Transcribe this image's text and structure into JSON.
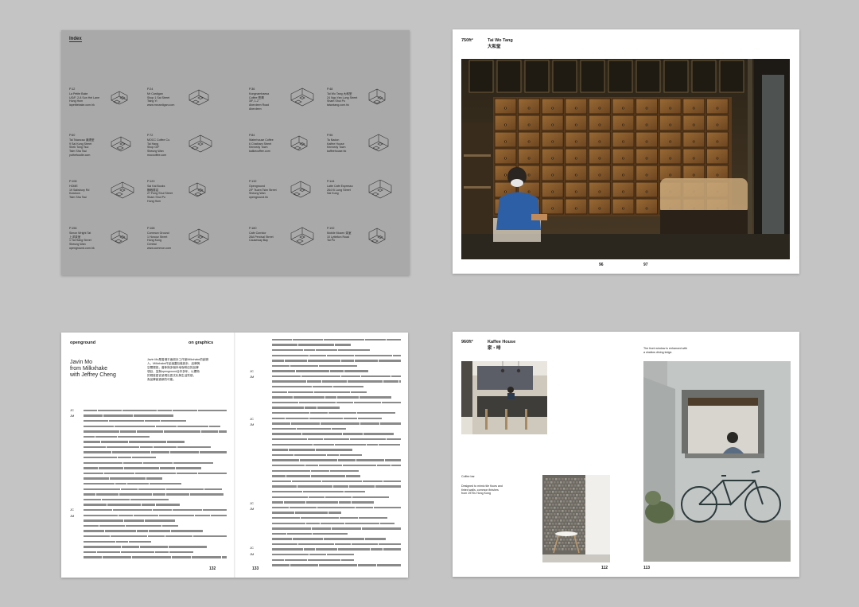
{
  "index": {
    "title": "Index",
    "entries": [
      {
        "num": "P.12",
        "lines": [
          "La Petite Bake",
          "UG/F, 2-8 Sun Hei Lane",
          "Hung Hom",
          "lapetitebake.com.hk"
        ]
      },
      {
        "num": "P.24",
        "lines": [
          "Mr Cardigan",
          "Shop 1 Sai Street",
          "Tsing Yi",
          "www.mrcardigan.com"
        ]
      },
      {
        "num": "P.36",
        "lines": [
          "Kongnamhaesa",
          "Coffee 豐潤",
          "3/F, 1-2",
          "Aberdeen Road",
          "Aberdeen"
        ]
      },
      {
        "num": "P.48",
        "lines": [
          "Tai Wo Tang 大和堂",
          "24 Ngo Yan Lung Street",
          "Sham Shui Po",
          "taiwotang.com.hk"
        ]
      },
      {
        "num": "P.60",
        "lines": [
          "Tai Tsiancau 滿湧堂",
          "9 Sai Kung Street",
          "Shek Tong Tsui",
          "Tsim Sha Tsui",
          "yuthefoodie.com"
        ]
      },
      {
        "num": "P.72",
        "lines": [
          "MOCC Coffee Co.",
          "Tai Hang",
          "Shop G/F",
          "Sheung Wan",
          "moccoffee.com"
        ]
      },
      {
        "num": "P.84",
        "lines": [
          "Waterhouse Coffee",
          "6 Chatham Street",
          "Kennedy Town",
          "kalikecoffee.com"
        ]
      },
      {
        "num": "P.96",
        "lines": [
          "Ta Nadon",
          "Kaffee House",
          "Kennedy Town",
          "kaffeehouse.hk"
        ]
      },
      {
        "num": "P.108",
        "lines": [
          "HOME",
          "19 Salisbury Rd",
          "Kowloon",
          "Tsim Sha Tsui"
        ]
      },
      {
        "num": "P.120",
        "lines": [
          "Sai Kai Books",
          "靜巷書店",
          "27 Fung Shui Street",
          "Sham Shui Po",
          "Hung Hom"
        ]
      },
      {
        "num": "P.132",
        "lines": [
          "Openground",
          "2/F Tsuen Tsim Street",
          "Sheung Wan",
          "openground.hk"
        ]
      },
      {
        "num": "P.144",
        "lines": [
          "Latte Cafe Espresso",
          "264 Ki Lung Street",
          "Sai Kung"
        ]
      },
      {
        "num": "P.156",
        "lines": [
          "Simon Wright Tat",
          "上洋茶室",
          "1 Tai Hang Street",
          "Sheung Wan",
          "openground.com.hk"
        ]
      },
      {
        "num": "P.168",
        "lines": [
          "Common Ground",
          "1 Honour Street",
          "Hong Kong",
          "Central",
          "www.common.com"
        ]
      },
      {
        "num": "P.180",
        "lines": [
          "Cafe Corridor",
          "26A Percival Street",
          "Causeway Bay"
        ]
      },
      {
        "num": "P.192",
        "lines": [
          "Mobile Mozen 茶室",
          "10 Lyttelton Road",
          "Tai Po"
        ]
      }
    ]
  },
  "tai_wo_tang": {
    "area": "750ft²",
    "name_en": "Tai Wo Tang",
    "name_zh": "大和堂",
    "page_left": "96",
    "page_right": "97",
    "photo_icon": "pharmacy-interior-photo"
  },
  "interview": {
    "venue": "openground",
    "section": "on graphics",
    "headline": [
      "Javin Mo",
      "from Milkxhake",
      "with Jeffrey Cheng"
    ],
    "intro_lines": [
      "Javin Mo是香港平面設計工作室Milkxhake的創辦",
      "人。Milkxhake作品涵蓋包裝設計、品牌與",
      "空間視覺，曾參與多個本地咖啡店的品牌",
      "項目，並與openground合作多年，以獨特",
      "的視覺語言呈現社區文化與生活質感，",
      "為品牌創造新的可能。"
    ],
    "labels_left": [
      "JC",
      "JM",
      "JC",
      "JM"
    ],
    "labels_right": [
      "JC",
      "JM",
      "JC",
      "JM",
      "JC",
      "JM",
      "JC",
      "JM"
    ],
    "page_left": "132",
    "page_right": "133"
  },
  "kaffee_house": {
    "area": "960ft²",
    "name_en": "Kaffee House",
    "name_zh": "家・啡",
    "caption_top": [
      "The front window is enhanced with",
      "a shallow dining ledge."
    ],
    "caption_left_1": "Coffee bar",
    "caption_left_2": [
      "Designed to mimic tile floors and",
      "tinted walls, common finishes",
      "from 1970s Hong Kong"
    ],
    "page_left": "112",
    "page_right": "113"
  },
  "colors": {
    "background": "#c4c4c4",
    "index_page": "#a9a9a9",
    "page": "#ffffff",
    "text": "#222222"
  }
}
